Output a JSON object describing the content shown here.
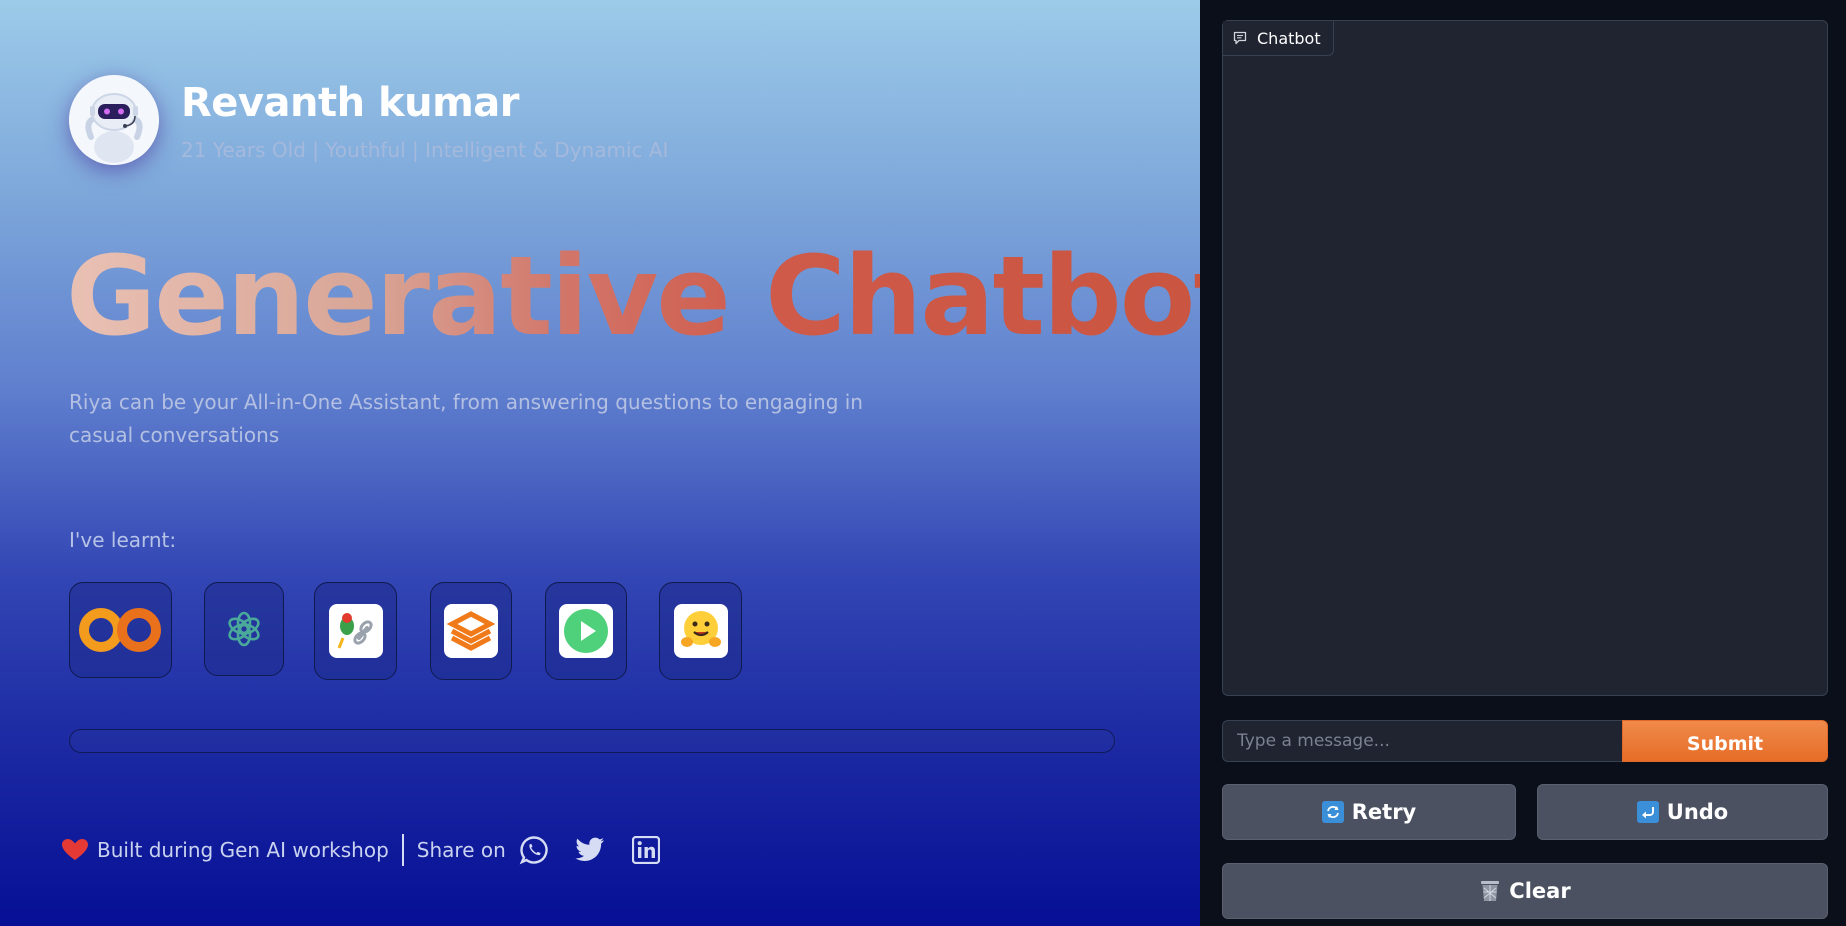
{
  "profile": {
    "name": "Revanth kumar",
    "tagline": "21 Years Old | Youthful | Intelligent & Dynamic AI"
  },
  "hero": {
    "title": "Generative Chatbot",
    "description": "Riya can be your All-in-One Assistant, from answering questions to engaging in casual conversations"
  },
  "learnt": {
    "label": "I've learnt:",
    "tools": [
      "colab-logo-icon",
      "openai-logo-icon",
      "langchain-logo-icon",
      "stack-logo-icon",
      "play-logo-icon",
      "huggingface-logo-icon"
    ]
  },
  "footer": {
    "built_text": "Built during Gen AI workshop",
    "share_text": "Share on",
    "share_icons": [
      "whatsapp-icon",
      "twitter-icon",
      "linkedin-icon"
    ]
  },
  "chat": {
    "label": "Chatbot",
    "input_placeholder": "Type a message...",
    "submit_label": "Submit",
    "retry_label": "Retry",
    "undo_label": "Undo",
    "clear_label": "Clear"
  },
  "colors": {
    "accent": "#e66d27",
    "panel": "#1f2430",
    "button": "#4b5160"
  }
}
